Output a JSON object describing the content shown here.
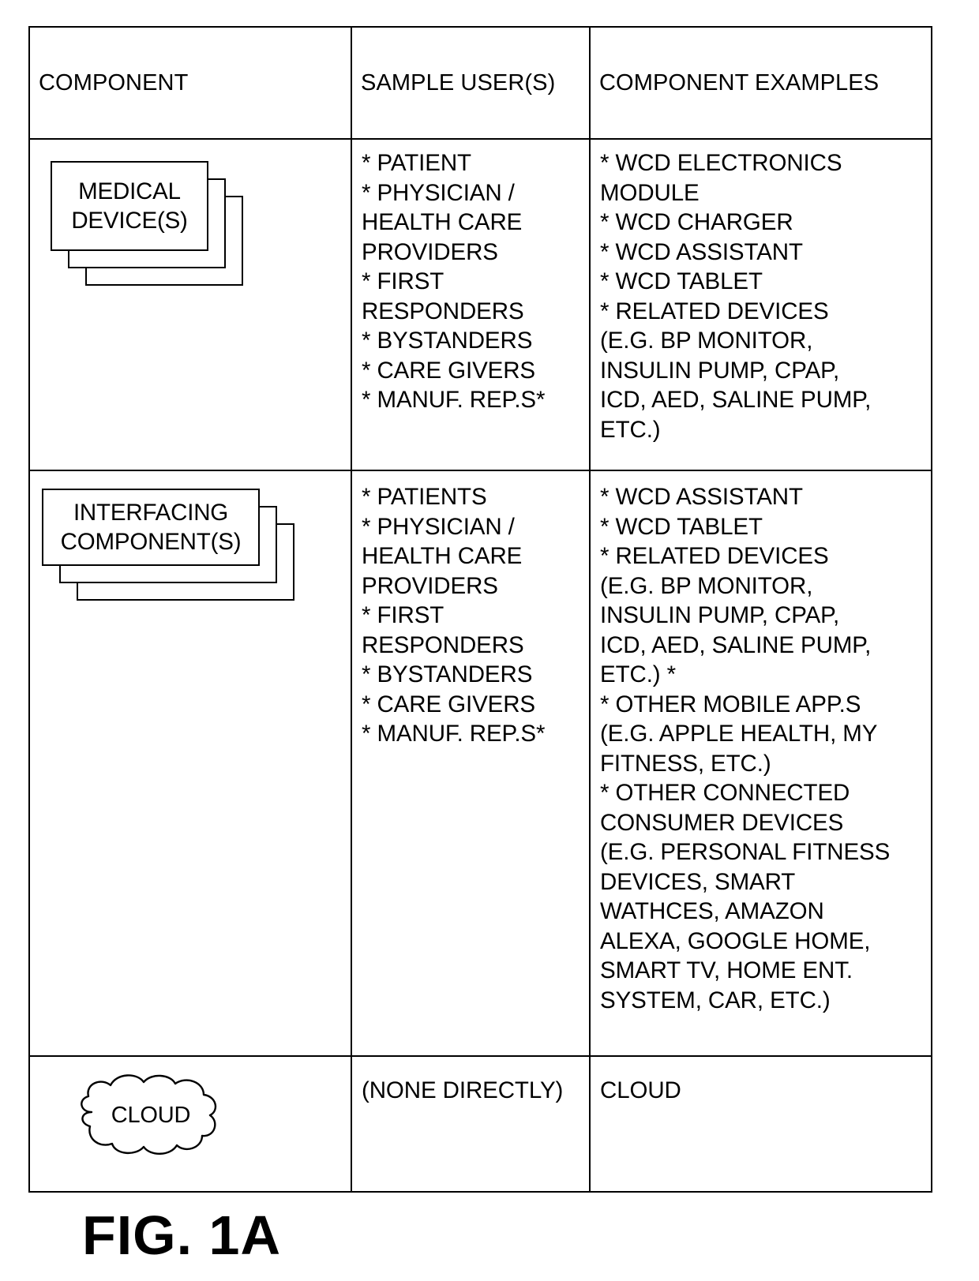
{
  "figure": {
    "caption": "FIG. 1A"
  },
  "table": {
    "headers": [
      "COMPONENT",
      "SAMPLE USER(S)",
      "COMPONENT EXAMPLES"
    ],
    "rows": [
      {
        "component_graphic": "stacked-boxes",
        "component_label": "MEDICAL\nDEVICE(S)",
        "sample_users": "* PATIENT\n* PHYSICIAN /\nHEALTH CARE\nPROVIDERS\n* FIRST\nRESPONDERS\n* BYSTANDERS\n* CARE GIVERS\n* MANUF. REP.S*",
        "component_examples": "* WCD ELECTRONICS\nMODULE\n* WCD CHARGER\n* WCD ASSISTANT\n* WCD TABLET\n* RELATED DEVICES\n(E.G. BP MONITOR,\nINSULIN PUMP, CPAP,\nICD, AED, SALINE PUMP,\nETC.)"
      },
      {
        "component_graphic": "stacked-boxes",
        "component_label": "INTERFACING\nCOMPONENT(S)",
        "sample_users": "* PATIENTS\n* PHYSICIAN /\nHEALTH CARE\nPROVIDERS\n* FIRST\nRESPONDERS\n* BYSTANDERS\n* CARE GIVERS\n* MANUF. REP.S*",
        "component_examples": "* WCD ASSISTANT\n* WCD TABLET\n* RELATED DEVICES\n(E.G. BP MONITOR,\nINSULIN PUMP, CPAP,\nICD, AED, SALINE PUMP,\nETC.) *\n* OTHER MOBILE APP.S\n(E.G. APPLE HEALTH, MY\nFITNESS, ETC.)\n* OTHER CONNECTED\nCONSUMER DEVICES\n(E.G. PERSONAL FITNESS\nDEVICES, SMART\nWATHCES, AMAZON\nALEXA, GOOGLE HOME,\nSMART TV, HOME ENT.\nSYSTEM, CAR, ETC.)"
      },
      {
        "component_graphic": "cloud",
        "component_label": "CLOUD",
        "sample_users": "(NONE DIRECTLY)",
        "component_examples": "CLOUD"
      }
    ]
  }
}
